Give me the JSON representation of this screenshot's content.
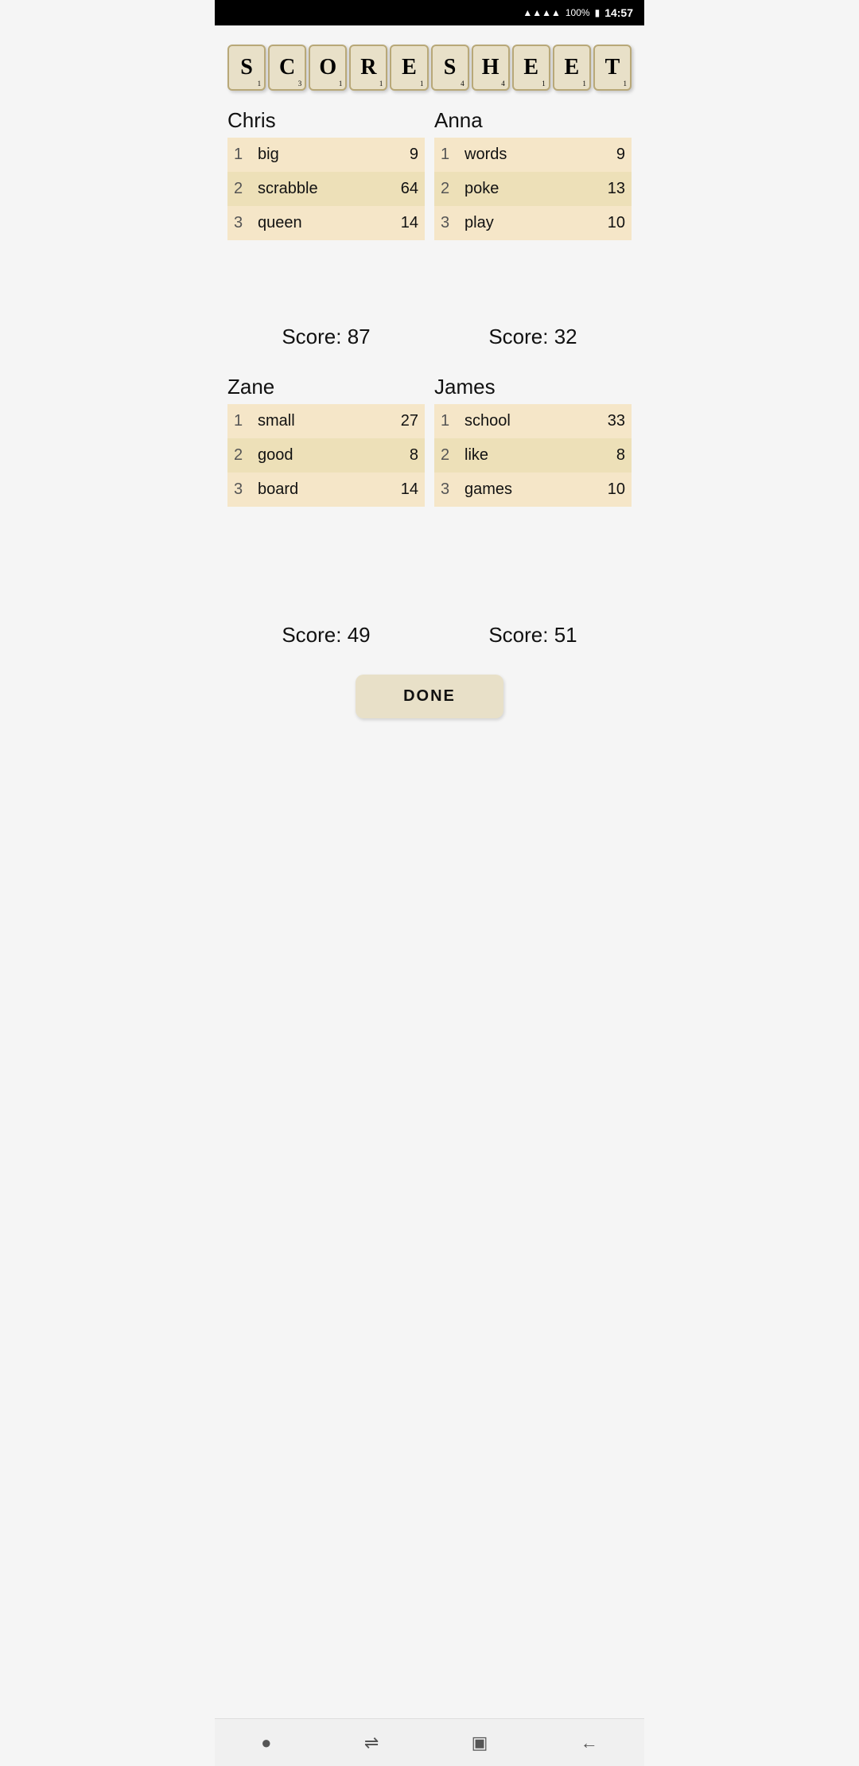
{
  "statusBar": {
    "signal": "▂▄▆█",
    "battery": "100%",
    "batteryIcon": "🔋",
    "time": "14:57"
  },
  "title": {
    "letters": [
      {
        "char": "S",
        "num": "1"
      },
      {
        "char": "C",
        "num": "3"
      },
      {
        "char": "O",
        "num": "1"
      },
      {
        "char": "R",
        "num": "1"
      },
      {
        "char": "E",
        "num": "1"
      },
      {
        "char": "S",
        "num": "4"
      },
      {
        "char": "H",
        "num": "4"
      },
      {
        "char": "E",
        "num": "1"
      },
      {
        "char": "E",
        "num": "1"
      },
      {
        "char": "T",
        "num": "1"
      }
    ]
  },
  "players": [
    {
      "name": "Chris",
      "moves": [
        {
          "num": 1,
          "word": "big",
          "score": 9
        },
        {
          "num": 2,
          "word": "scrabble",
          "score": 64
        },
        {
          "num": 3,
          "word": "queen",
          "score": 14
        }
      ],
      "total": 87
    },
    {
      "name": "Anna",
      "moves": [
        {
          "num": 1,
          "word": "words",
          "score": 9
        },
        {
          "num": 2,
          "word": "poke",
          "score": 13
        },
        {
          "num": 3,
          "word": "play",
          "score": 10
        }
      ],
      "total": 32
    },
    {
      "name": "Zane",
      "moves": [
        {
          "num": 1,
          "word": "small",
          "score": 27
        },
        {
          "num": 2,
          "word": "good",
          "score": 8
        },
        {
          "num": 3,
          "word": "board",
          "score": 14
        }
      ],
      "total": 49
    },
    {
      "name": "James",
      "moves": [
        {
          "num": 1,
          "word": "school",
          "score": 33
        },
        {
          "num": 2,
          "word": "like",
          "score": 8
        },
        {
          "num": 3,
          "word": "games",
          "score": 10
        }
      ],
      "total": 51
    }
  ],
  "doneLabel": "DONE",
  "nav": {
    "homeIcon": "●",
    "menuIcon": "⇌",
    "windowIcon": "▣",
    "backIcon": "←"
  }
}
